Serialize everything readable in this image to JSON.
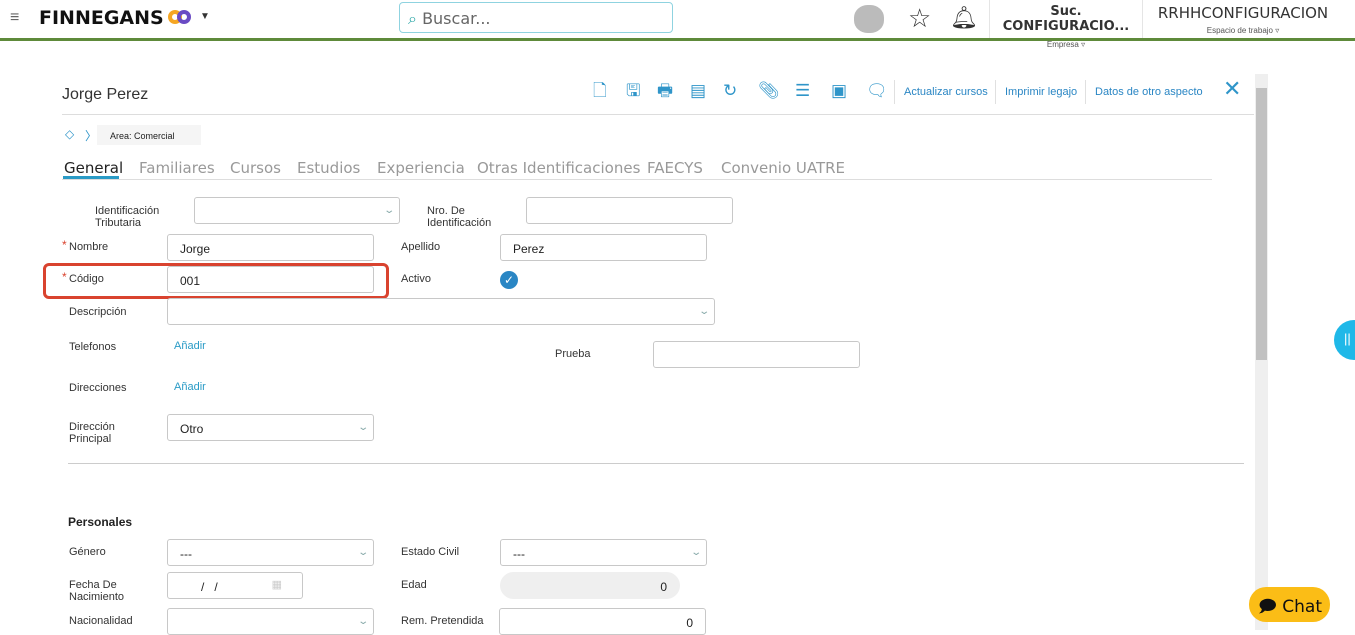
{
  "header": {
    "brand": "FINNEGANS",
    "search_placeholder": "Buscar...",
    "company": "Suc. CONFIGURACIO...",
    "company_label": "Empresa",
    "workspace": "RRHHCONFIGURACION",
    "workspace_label": "Espacio de trabajo"
  },
  "record": {
    "title": "Jorge Perez",
    "breadcrumb": "Area: Comercial"
  },
  "toolbar": {
    "actions": [
      "Actualizar cursos",
      "Imprimir legajo",
      "Datos de otro aspecto"
    ]
  },
  "tabs": [
    "General",
    "Familiares",
    "Cursos",
    "Estudios",
    "Experiencia",
    "Otras Identificaciones",
    "FAECYS",
    "Convenio UATRE"
  ],
  "general": {
    "id_tributaria_label": "Identificación Tributaria",
    "id_tributaria": "",
    "nro_id_label": "Nro. De Identificación",
    "nro_id": "",
    "nombre_label": "Nombre",
    "nombre": "Jorge",
    "apellido_label": "Apellido",
    "apellido": "Perez",
    "codigo_label": "Código",
    "codigo": "001",
    "activo_label": "Activo",
    "descripcion_label": "Descripción",
    "telefonos_label": "Telefonos",
    "telefonos_add": "Añadir",
    "prueba_label": "Prueba",
    "direcciones_label": "Direcciones",
    "direcciones_add": "Añadir",
    "dir_principal_label": "Dirección Principal",
    "dir_principal": "Otro"
  },
  "personales": {
    "title": "Personales",
    "genero_label": "Género",
    "genero": "---",
    "estado_civil_label": "Estado Civil",
    "estado_civil": "---",
    "fecha_label": "Fecha De Nacimiento",
    "fecha": "/   /",
    "edad_label": "Edad",
    "edad": "0",
    "nacionalidad_label": "Nacionalidad",
    "rem_label": "Rem. Pretendida",
    "rem": "0"
  },
  "chat": {
    "label": "Chat"
  },
  "colors": {
    "accent": "#2a86c4",
    "header_line": "#5e8a3a",
    "highlight": "#d9432f",
    "chat": "#fbbd16"
  }
}
